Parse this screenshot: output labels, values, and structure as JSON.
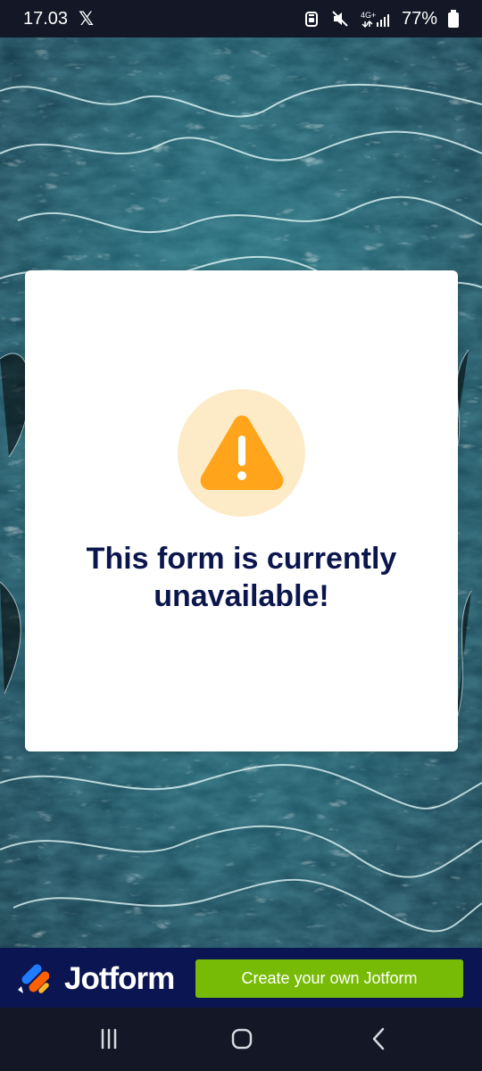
{
  "status_bar": {
    "time": "17.03",
    "x_logo": "𝕏",
    "network": "4G+",
    "battery_percent": "77%"
  },
  "card": {
    "title": "This form is currently unavailable!",
    "warning_icon": "warning-icon"
  },
  "brand": {
    "name": "Jotform",
    "cta_label": "Create your own Jotform"
  },
  "navigation": {
    "recent_icon": "recent-apps-icon",
    "home_icon": "home-icon",
    "back_icon": "back-icon"
  },
  "colors": {
    "status_bar_bg": "#141826",
    "card_bg": "#ffffff",
    "title_text": "#0b164d",
    "warning_orange": "#ffa41b",
    "warning_circle": "#fdebc8",
    "brand_bar_bg": "#0a1551",
    "cta_green": "#78bb07",
    "nav_bar_bg": "#141826"
  }
}
